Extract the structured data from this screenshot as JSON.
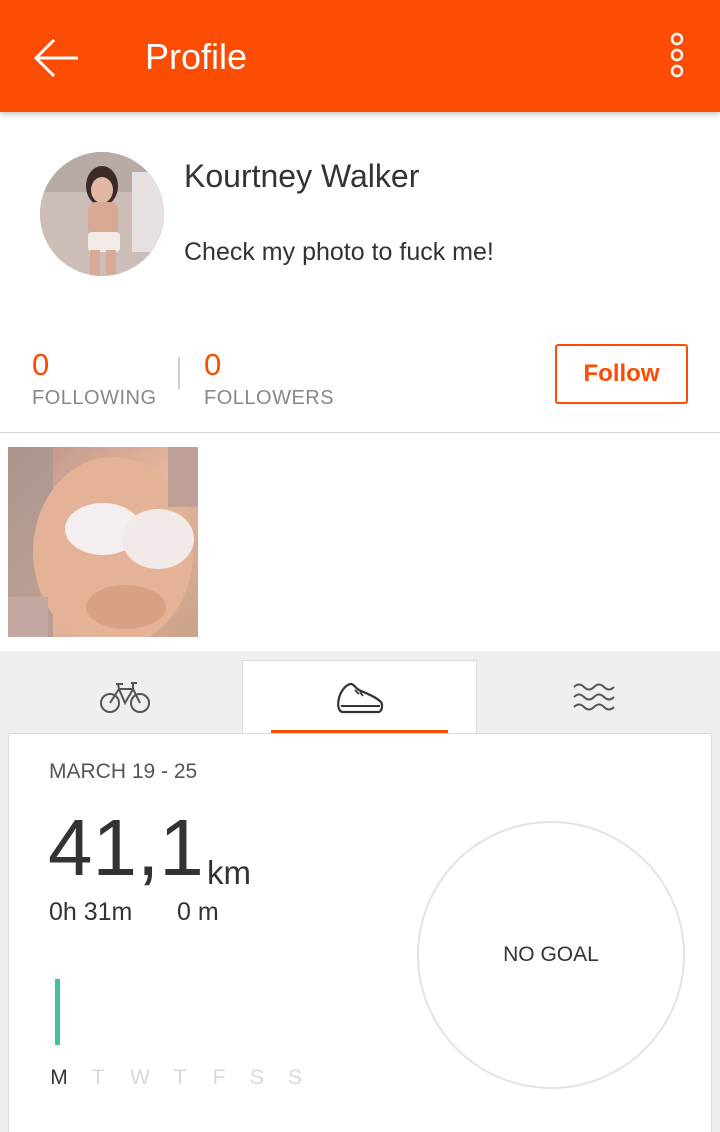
{
  "appbar": {
    "title": "Profile",
    "background": "#fc4c02",
    "back_icon": "arrow-left-icon",
    "menu_icon": "more-vert-icon"
  },
  "profile": {
    "name": "Kourtney Walker",
    "bio": "Check my photo to fuck me!",
    "avatar": "profile-photo"
  },
  "stats": {
    "following_count": "0",
    "following_label": "FOLLOWING",
    "followers_count": "0",
    "followers_label": "FOLLOWERS",
    "follow_button": "Follow"
  },
  "photos": [
    {
      "name": "user-photo"
    }
  ],
  "activity_tabs": [
    {
      "icon": "bike-icon",
      "active": false
    },
    {
      "icon": "shoe-icon",
      "active": true
    },
    {
      "icon": "swim-icon",
      "active": false
    }
  ],
  "weekly": {
    "date_range": "MARCH 19 - 25",
    "distance": "41,1",
    "distance_unit": "km",
    "time": "0h 31m",
    "elevation": "0 m",
    "goal_text": "NO GOAL",
    "days": [
      "M",
      "T",
      "W",
      "T",
      "F",
      "S",
      "S"
    ],
    "active_day_index": 0,
    "bar_color": "#3fc1a0"
  },
  "colors": {
    "accent": "#fc4c02",
    "text": "#333333",
    "muted": "#888888"
  }
}
